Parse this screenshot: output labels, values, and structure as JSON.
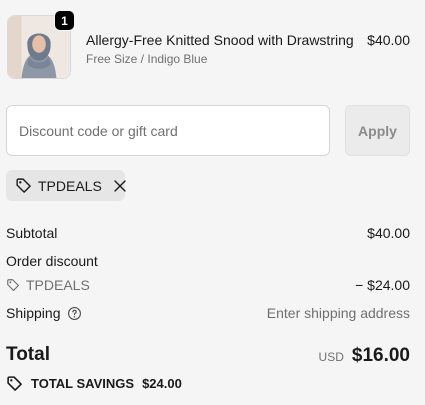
{
  "line_item": {
    "quantity": "1",
    "title": "Allergy-Free Knitted Snood with Drawstring",
    "variant": "Free Size / Indigo Blue",
    "price": "$40.00"
  },
  "discount": {
    "placeholder": "Discount code or gift card",
    "apply_label": "Apply"
  },
  "applied_code": {
    "code": "TPDEALS",
    "icon": "tag-icon",
    "remove_icon": "close-icon"
  },
  "summary": {
    "subtotal_label": "Subtotal",
    "subtotal_value": "$40.00",
    "order_discount_label": "Order discount",
    "discount_code": "TPDEALS",
    "discount_value": "− $24.00",
    "shipping_label": "Shipping",
    "shipping_value": "Enter shipping address",
    "total_label": "Total",
    "currency": "USD",
    "total_value": "$16.00",
    "savings_label": "TOTAL SAVINGS",
    "savings_value": "$24.00"
  },
  "colors": {
    "background": "#f5f5f5",
    "text": "#1a1a1a",
    "muted": "#707070",
    "chip": "#e6e6e6"
  }
}
